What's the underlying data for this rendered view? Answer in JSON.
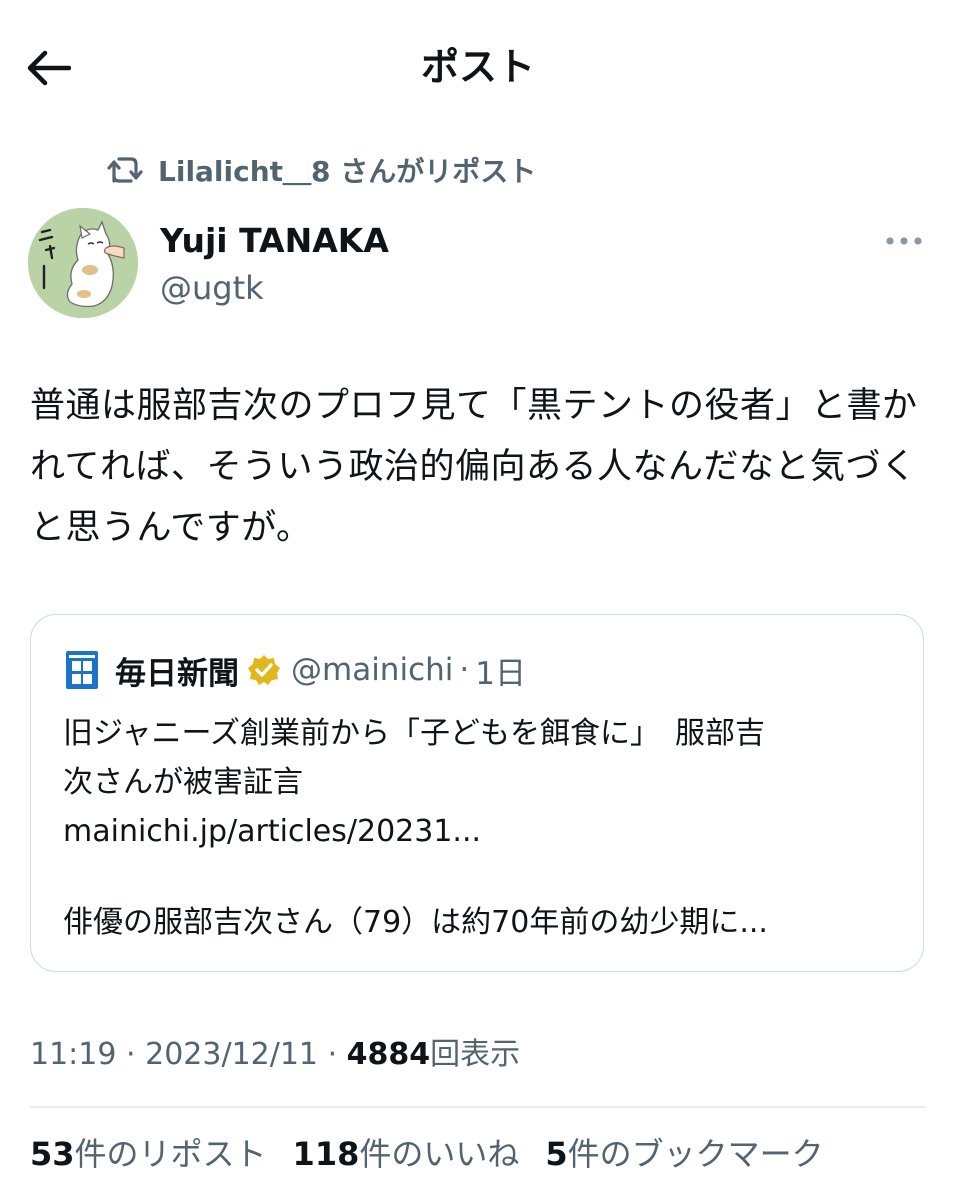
{
  "header": {
    "title": "ポスト",
    "back_icon": "arrow-left-icon"
  },
  "repost_context": {
    "icon": "repost-icon",
    "text": "Lilalicht＿8 さんがリポスト"
  },
  "author": {
    "name": "Yuji TANAKA",
    "handle": "@ugtk",
    "avatar_text": "ニャー"
  },
  "tweet": {
    "text": "普通は服部吉次のプロフ見て「黒テントの役者」と書かれてれば、そういう政治的偏向ある人なんだなと気づくと思うんですが。"
  },
  "quote": {
    "name": "毎日新聞",
    "logo_text": "新毎日聞",
    "handle": "@mainichi",
    "separator": "·",
    "time": "1日",
    "lines": [
      "旧ジャニーズ創業前から「子どもを餌食に」　服部吉",
      "次さんが被害証言",
      "mainichi.jp/articles/20231..."
    ],
    "summary": "俳優の服部吉次さん（79）は約70年前の幼少期に..."
  },
  "meta": {
    "time": "11:19",
    "date": "2023/12/11",
    "separator": "·",
    "views_count": "4884",
    "views_label": "回表示"
  },
  "stats": {
    "reposts_count": "53",
    "reposts_label": "件のリポスト",
    "likes_count": "118",
    "likes_label": "件のいいね",
    "bookmarks_count": "5",
    "bookmarks_label": "件のブックマーク"
  },
  "colors": {
    "text": "#0f1419",
    "secondary": "#536471",
    "border": "#cfd9de",
    "verified_gold": "#e2b719",
    "mainichi_blue": "#1d73c9"
  }
}
